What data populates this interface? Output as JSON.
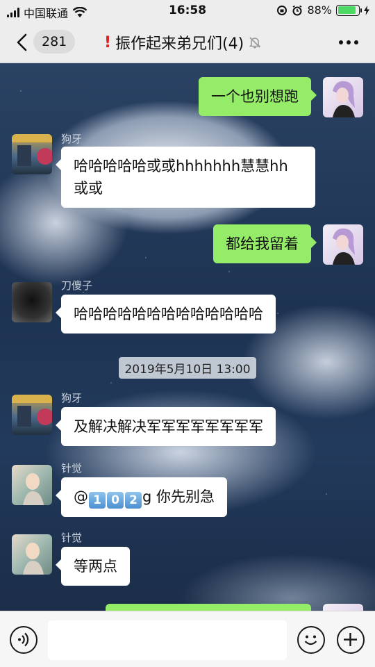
{
  "status_bar": {
    "carrier": "中国联通",
    "time": "16:58",
    "battery_percent": "88%",
    "battery_level": 0.88
  },
  "nav": {
    "unread_count": "281",
    "title_mark": "!",
    "title": "振作起来弟兄们(4)",
    "icons": [
      "back-chevron-icon",
      "muted-bell-icon",
      "more-icon"
    ]
  },
  "chat": {
    "messages": [
      {
        "direction": "out",
        "text": "一个也别想跑"
      },
      {
        "direction": "in",
        "sender": "狗牙",
        "text_line1": "哈哈哈哈哈或或hhhhhhh慧慧hh",
        "text_line2": "或或"
      },
      {
        "direction": "out",
        "text": "都给我留着"
      },
      {
        "direction": "in",
        "sender": "刀傻子",
        "text": "哈哈哈哈哈哈哈哈哈哈哈哈哈"
      },
      {
        "direction": "in",
        "sender": "狗牙",
        "text": "及解决解决军军军军军军军军"
      },
      {
        "direction": "in",
        "sender": "针觉",
        "prefix": "@",
        "keycaps": [
          "1",
          "0",
          "2"
        ],
        "suffix": "g 你先别急"
      },
      {
        "direction": "in",
        "sender": "针觉",
        "text": "等两点"
      }
    ],
    "timestamp": "2019年5月10日 13:00"
  },
  "input_bar": {
    "value": "",
    "icons": [
      "voice-icon",
      "emoji-icon",
      "plus-icon"
    ]
  },
  "colors": {
    "out_bubble": "#95ec69",
    "in_bubble": "#ffffff",
    "bar_bg": "#ededed"
  }
}
